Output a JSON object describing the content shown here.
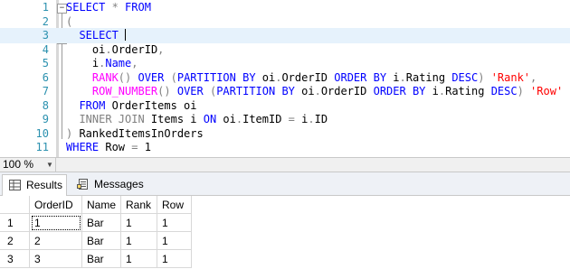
{
  "editor": {
    "lines": [
      {
        "n": "1",
        "parts": [
          {
            "t": "SELECT",
            "c": "kw"
          },
          {
            "t": " * ",
            "c": "gr"
          },
          {
            "t": "FROM",
            "c": "kw"
          }
        ]
      },
      {
        "n": "2",
        "parts": [
          {
            "t": "(",
            "c": "gr"
          }
        ]
      },
      {
        "n": "3",
        "parts": [
          {
            "t": "  SELECT ",
            "c": "kw"
          }
        ]
      },
      {
        "n": "4",
        "parts": [
          {
            "t": "    oi",
            "c": "tx"
          },
          {
            "t": ".",
            "c": "gr"
          },
          {
            "t": "OrderID",
            "c": "tx"
          },
          {
            "t": ",",
            "c": "gr"
          }
        ]
      },
      {
        "n": "5",
        "parts": [
          {
            "t": "    i",
            "c": "tx"
          },
          {
            "t": ".",
            "c": "gr"
          },
          {
            "t": "Name",
            "c": "kw"
          },
          {
            "t": ",",
            "c": "gr"
          }
        ]
      },
      {
        "n": "6",
        "parts": [
          {
            "t": "    RANK",
            "c": "fn"
          },
          {
            "t": "() ",
            "c": "gr"
          },
          {
            "t": "OVER ",
            "c": "kw"
          },
          {
            "t": "(",
            "c": "gr"
          },
          {
            "t": "PARTITION BY ",
            "c": "kw"
          },
          {
            "t": "oi",
            "c": "tx"
          },
          {
            "t": ".",
            "c": "gr"
          },
          {
            "t": "OrderID ",
            "c": "tx"
          },
          {
            "t": "ORDER BY ",
            "c": "kw"
          },
          {
            "t": "i",
            "c": "tx"
          },
          {
            "t": ".",
            "c": "gr"
          },
          {
            "t": "Rating ",
            "c": "tx"
          },
          {
            "t": "DESC",
            "c": "kw"
          },
          {
            "t": ") ",
            "c": "gr"
          },
          {
            "t": "'Rank'",
            "c": "str"
          },
          {
            "t": ",",
            "c": "gr"
          }
        ]
      },
      {
        "n": "7",
        "parts": [
          {
            "t": "    ROW_NUMBER",
            "c": "fn"
          },
          {
            "t": "() ",
            "c": "gr"
          },
          {
            "t": "OVER ",
            "c": "kw"
          },
          {
            "t": "(",
            "c": "gr"
          },
          {
            "t": "PARTITION BY ",
            "c": "kw"
          },
          {
            "t": "oi",
            "c": "tx"
          },
          {
            "t": ".",
            "c": "gr"
          },
          {
            "t": "OrderID ",
            "c": "tx"
          },
          {
            "t": "ORDER BY ",
            "c": "kw"
          },
          {
            "t": "i",
            "c": "tx"
          },
          {
            "t": ".",
            "c": "gr"
          },
          {
            "t": "Rating ",
            "c": "tx"
          },
          {
            "t": "DESC",
            "c": "kw"
          },
          {
            "t": ") ",
            "c": "gr"
          },
          {
            "t": "'Row'",
            "c": "str"
          }
        ]
      },
      {
        "n": "8",
        "parts": [
          {
            "t": "  FROM ",
            "c": "kw"
          },
          {
            "t": "OrderItems oi",
            "c": "tx"
          }
        ]
      },
      {
        "n": "9",
        "parts": [
          {
            "t": "  INNER JOIN ",
            "c": "gr"
          },
          {
            "t": "Items i ",
            "c": "tx"
          },
          {
            "t": "ON ",
            "c": "kw"
          },
          {
            "t": "oi",
            "c": "tx"
          },
          {
            "t": ".",
            "c": "gr"
          },
          {
            "t": "ItemID ",
            "c": "tx"
          },
          {
            "t": "= ",
            "c": "gr"
          },
          {
            "t": "i",
            "c": "tx"
          },
          {
            "t": ".",
            "c": "gr"
          },
          {
            "t": "ID",
            "c": "tx"
          }
        ]
      },
      {
        "n": "10",
        "parts": [
          {
            "t": ") ",
            "c": "gr"
          },
          {
            "t": "RankedItemsInOrders",
            "c": "tx"
          }
        ]
      },
      {
        "n": "11",
        "parts": [
          {
            "t": "WHERE ",
            "c": "kw"
          },
          {
            "t": "Row ",
            "c": "tx"
          },
          {
            "t": "= ",
            "c": "gr"
          },
          {
            "t": "1",
            "c": "tx"
          }
        ]
      }
    ]
  },
  "status": {
    "zoom": "100 %"
  },
  "tabs": [
    {
      "label": "Results"
    },
    {
      "label": "Messages"
    }
  ],
  "results": {
    "columns": [
      "OrderID",
      "Name",
      "Rank",
      "Row"
    ],
    "rows": [
      {
        "n": "1",
        "cells": [
          "1",
          "Bar",
          "1",
          "1"
        ]
      },
      {
        "n": "2",
        "cells": [
          "2",
          "Bar",
          "1",
          "1"
        ]
      },
      {
        "n": "3",
        "cells": [
          "3",
          "Bar",
          "1",
          "1"
        ]
      }
    ]
  }
}
